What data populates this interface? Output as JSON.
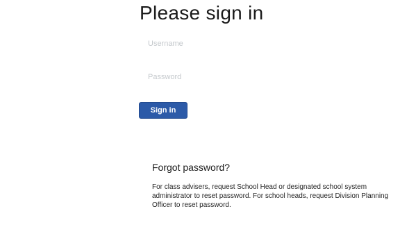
{
  "signin": {
    "heading": "Please sign in",
    "username_placeholder": "Username",
    "password_placeholder": "Password",
    "button_label": "Sign in"
  },
  "forgot": {
    "heading": "Forgot password?",
    "text": "For class advisers, request School Head or designated school system administrator to reset password. For school heads, request Division Planning Officer to reset password."
  },
  "colors": {
    "button": "#2c5aa8",
    "button_text": "#ffffff",
    "placeholder": "#c4c8cc"
  }
}
